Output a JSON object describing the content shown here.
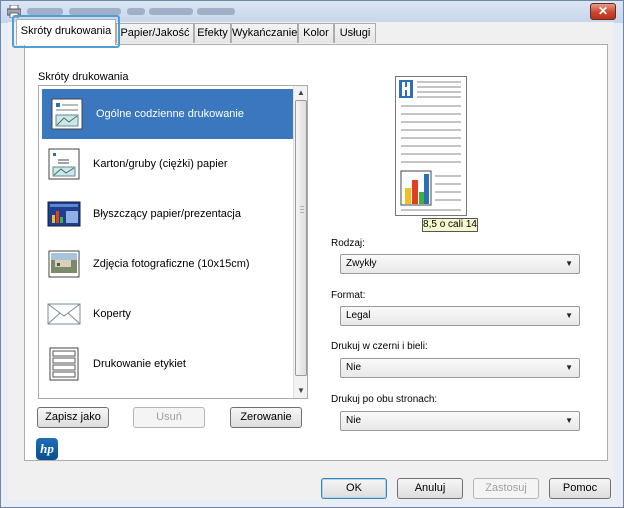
{
  "window": {
    "close_icon": "close-icon",
    "app_icon": "printer-icon"
  },
  "tabs": [
    {
      "label": "Skróty drukowania",
      "active": true
    },
    {
      "label": "Papier/Jakość"
    },
    {
      "label": "Efekty"
    },
    {
      "label": "Wykańczanie"
    },
    {
      "label": "Kolor"
    },
    {
      "label": "Usługi"
    }
  ],
  "shortcuts": {
    "group_label": "Skróty drukowania",
    "items": [
      {
        "label": "Ogólne codzienne drukowanie",
        "icon": "everyday-print-icon",
        "selected": true
      },
      {
        "label": "Karton/gruby (ciężki) papier",
        "icon": "cardstock-icon"
      },
      {
        "label": "Błyszczący papier/prezentacja",
        "icon": "glossy-presentation-icon"
      },
      {
        "label": "Zdjęcia fotograficzne (10x15cm)",
        "icon": "photo-icon"
      },
      {
        "label": "Koperty",
        "icon": "envelope-icon"
      },
      {
        "label": "Drukowanie etykiet",
        "icon": "labels-icon"
      }
    ],
    "save_as": "Zapisz jako",
    "delete": "Usuń",
    "reset": "Zerowanie"
  },
  "preview": {
    "size_label": "8,5 o cali 14"
  },
  "settings": {
    "type": {
      "label": "Rodzaj:",
      "value": "Zwykły"
    },
    "format": {
      "label": "Format:",
      "value": "Legal"
    },
    "grayscale": {
      "label": "Drukuj w czerni i bieli:",
      "value": "Nie"
    },
    "duplex": {
      "label": "Drukuj po obu stronach:",
      "value": "Nie"
    }
  },
  "footer": {
    "ok": "OK",
    "cancel": "Anuluj",
    "apply": "Zastosuj",
    "help": "Pomoc"
  },
  "colors": {
    "selection": "#3b77bf",
    "tab_focus": "#4f9ed6",
    "close_button": "#c9462d"
  }
}
